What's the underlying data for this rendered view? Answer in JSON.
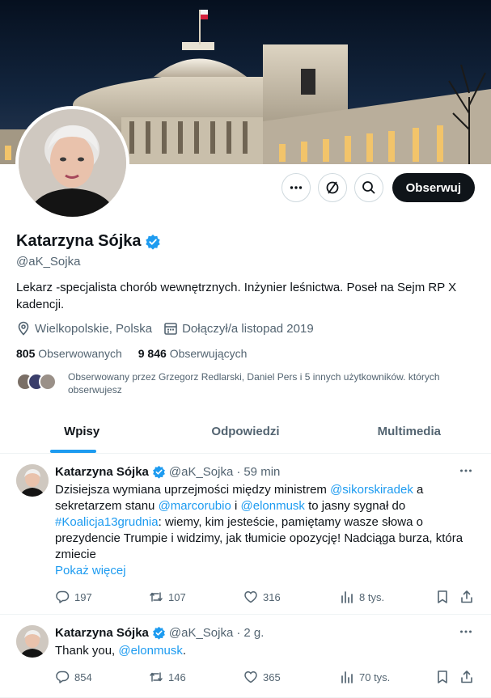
{
  "profile": {
    "name": "Katarzyna Sójka",
    "handle": "@aK_Sojka",
    "bio": "Lekarz -specjalista chorób wewnętrznych. Inżynier leśnictwa. Poseł na Sejm RP X kadencji.",
    "location": "Wielkopolskie, Polska",
    "joined": "Dołączył/a listopad 2019",
    "following_count": "805",
    "following_label": "Obserwowanych",
    "followers_count": "9 846",
    "followers_label": "Obserwujących",
    "followed_by": "Obserwowany przez Grzegorz Redlarski, Daniel Pers i 5 innych użytkowników. których obserwujesz"
  },
  "actions": {
    "more_icon": "more-icon",
    "subscribe_icon": "notification-icon",
    "search_icon": "search-icon",
    "follow_label": "Obserwuj"
  },
  "tabs": [
    {
      "label": "Wpisy",
      "active": true
    },
    {
      "label": "Odpowiedzi",
      "active": false
    },
    {
      "label": "Multimedia",
      "active": false
    }
  ],
  "tweets": [
    {
      "name": "Katarzyna Sójka",
      "handle": "@aK_Sojka",
      "time": "59 min",
      "text": {
        "p1": "Dzisiejsza wymiana uprzejmości między ministrem ",
        "m1": "@sikorskiradek",
        "p2": " a sekretarzem stanu ",
        "m2": "@marcorubio",
        "p3": " i ",
        "m3": "@elonmusk",
        "p4": " to jasny sygnał do ",
        "h1": "#Koalicja13grudnia",
        "p5": ": wiemy, kim jesteście, pamiętamy wasze słowa o prezydencie Trumpie i widzimy, jak tłumicie opozycję! Nadciąga burza, która zmiecie"
      },
      "show_more": "Pokaż więcej",
      "replies": "197",
      "retweets": "107",
      "likes": "316",
      "views": "8 tys."
    },
    {
      "name": "Katarzyna Sójka",
      "handle": "@aK_Sojka",
      "time": "2 g.",
      "text": {
        "p1": "Thank you, ",
        "m1": "@elonmusk",
        "p2": "."
      },
      "replies": "854",
      "retweets": "146",
      "likes": "365",
      "views": "70 tys."
    }
  ],
  "colors": {
    "accent": "#1d9bf0",
    "text": "#0f1419",
    "secondary": "#536471",
    "verified": "#1d9bf0"
  }
}
